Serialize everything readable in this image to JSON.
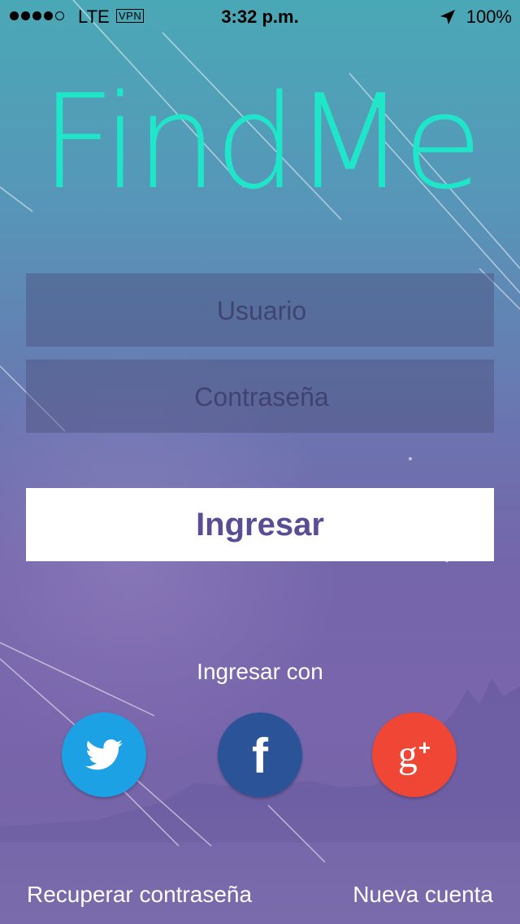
{
  "status_bar": {
    "carrier": "LTE",
    "vpn": "VPN",
    "time": "3:32 p.m.",
    "battery": "100%",
    "icons": [
      "signal-dots",
      "location-arrow-icon"
    ]
  },
  "app": {
    "logo": "FindMe"
  },
  "form": {
    "username_placeholder": "Usuario",
    "password_placeholder": "Contraseña",
    "login_label": "Ingresar"
  },
  "social": {
    "heading": "Ingresar con",
    "buttons": [
      {
        "icon": "twitter-bird-icon",
        "color": "#1da1e5"
      },
      {
        "icon": "facebook-f-icon",
        "color": "#2b5397",
        "glyph": "f"
      },
      {
        "icon": "google-plus-icon",
        "color": "#f04636",
        "glyph": "g"
      }
    ]
  },
  "links": {
    "recover": "Recuperar contraseña",
    "new_account": "Nueva cuenta"
  },
  "colors": {
    "logo": "#1fe6c9",
    "login_text": "#5a4d93",
    "background_top": "#4aa8b6",
    "background_bottom": "#7c6aa9"
  }
}
